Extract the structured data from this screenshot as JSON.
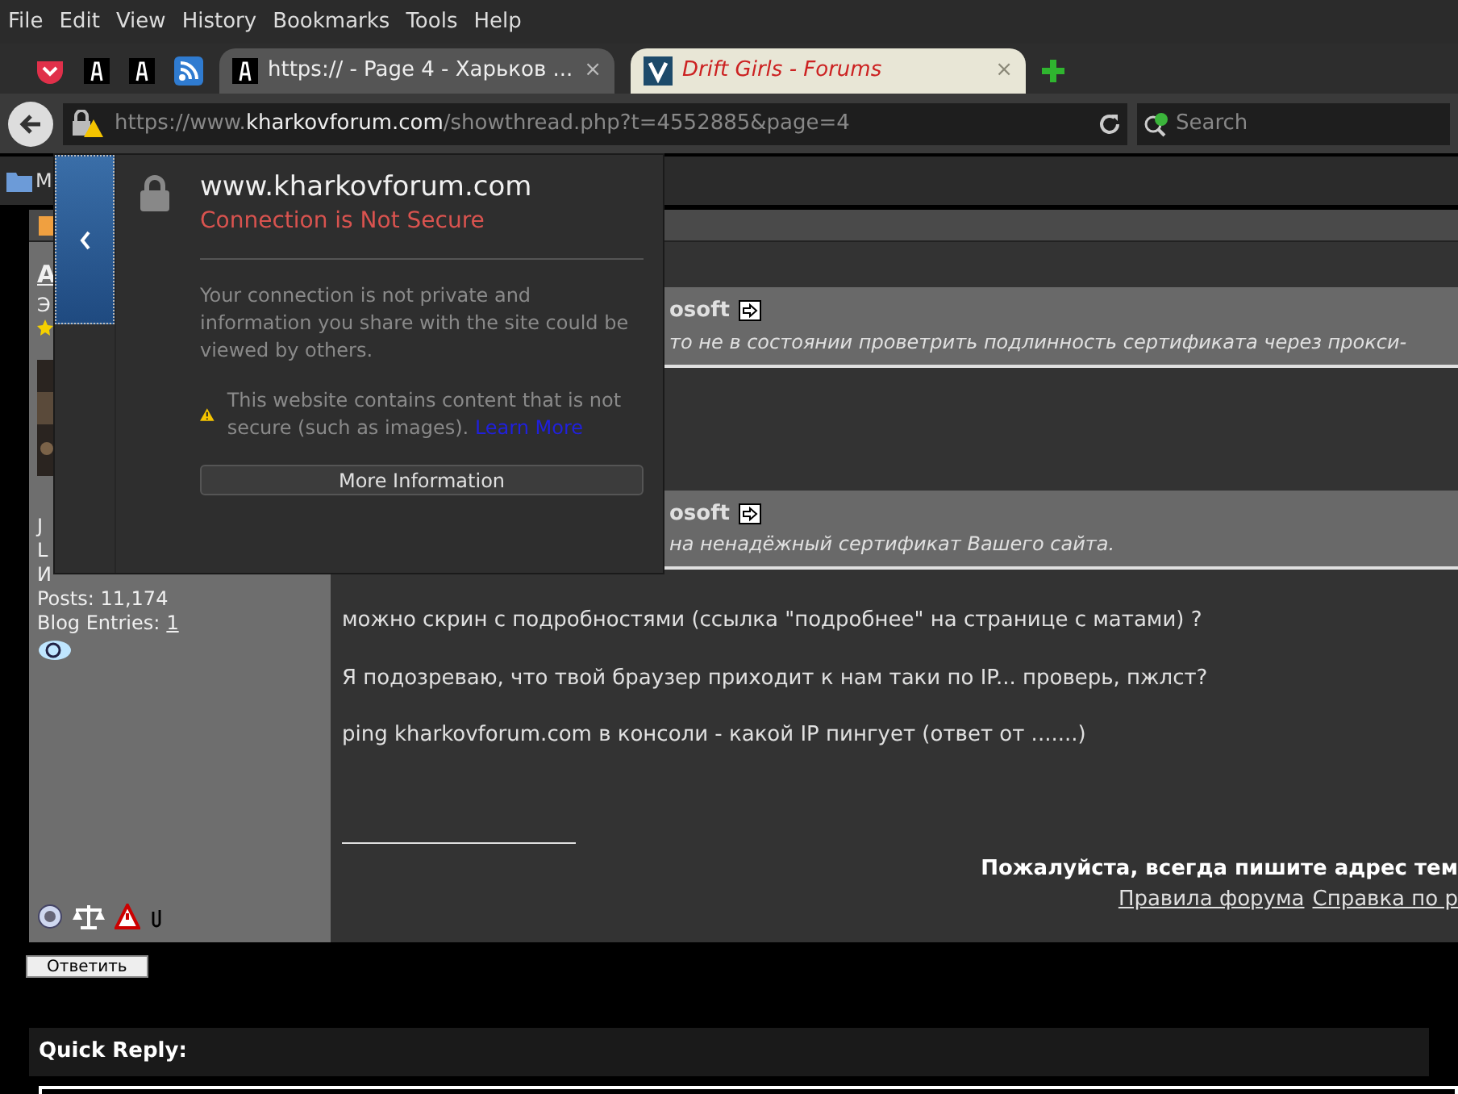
{
  "menu": [
    "File",
    "Edit",
    "View",
    "History",
    "Bookmarks",
    "Tools",
    "Help"
  ],
  "tabs": [
    {
      "title": "https:// - Page 4 - Харьков ...",
      "close": "×",
      "selected": true
    },
    {
      "title": "Drift Girls - Forums",
      "close": "×",
      "selected": false
    }
  ],
  "address_bar": {
    "prefix": "https://www.",
    "domain": "kharkovforum.com",
    "path": "/showthread.php?t=4552885&page=4"
  },
  "search": {
    "placeholder": "Search"
  },
  "bookmarks": [
    {
      "label": "M"
    }
  ],
  "site_popup": {
    "host": "www.kharkovforum.com",
    "status": "Connection is Not Secure",
    "message": "Your connection is not private and information you share with the site could be viewed by others.",
    "warning": "This website contains content that is not secure (such as images).",
    "link": "Learn More",
    "button": "More Information"
  },
  "sidebar": {
    "fragments": [
      "A",
      "Э",
      "J",
      "L",
      "И"
    ],
    "posts": "Posts: 11,174",
    "blog_label": "Blog Entries:",
    "blog_count": "1"
  },
  "quotes": [
    {
      "author": "osoft",
      "text": "то не в состоянии проветрить подлинность сертификата через прокси-"
    },
    {
      "author": "osoft",
      "text": "на ненадёжный сертификат Вашего сайта."
    }
  ],
  "post_lines": [
    "можно скрин с подробностями (ссылка \"подробнее\" на странице с матами) ?",
    "Я подозреваю, что твой браузер приходит к нам таки по IP... проверь, пжлст?",
    "ping kharkovforum.com в консоли - какой IP пингует (ответ от .......)"
  ],
  "signature": {
    "notice": "Пожалуйста, всегда пишите адрес тем",
    "links": [
      "Правила форума",
      "Справка по р"
    ]
  },
  "reply_button": "Ответить",
  "quick_reply": {
    "title": "Quick Reply:"
  }
}
